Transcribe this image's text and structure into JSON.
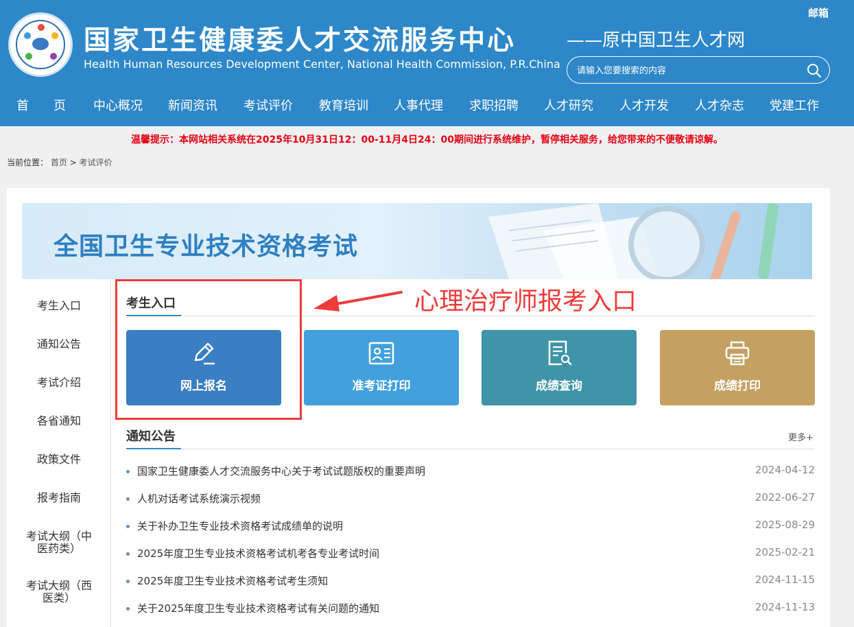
{
  "header": {
    "title_cn": "国家卫生健康委人才交流服务中心",
    "title_en": "Health Human Resources Development Center, National Health Commission, P.R.China",
    "subtitle": "——原中国卫生人才网",
    "mail_link": "邮箱",
    "search": {
      "placeholder": "请输入您要搜索的内容"
    },
    "nav": [
      "首　　页",
      "中心概况",
      "新闻资讯",
      "考试评价",
      "教育培训",
      "人事代理",
      "求职招聘",
      "人才研究",
      "人才开发",
      "人才杂志",
      "党建工作"
    ]
  },
  "notice": "温馨提示：本网站相关系统在2025年10月31日12：00-11月4日24：00期间进行系统维护，暂停相关服务，给您带来的不便敬请谅解。",
  "breadcrumb": {
    "label": "当前位置：",
    "home": "首页",
    "sep": " > ",
    "current": "考试评价"
  },
  "banner": {
    "title": "全国卫生专业技术资格考试"
  },
  "sidebar": [
    "考生入口",
    "通知公告",
    "考试介绍",
    "各省通知",
    "政策文件",
    "报考指南",
    "考试大纲（中医药类）",
    "考试大纲（西医类）"
  ],
  "entry": {
    "title": "考生入口",
    "buttons": [
      {
        "label": "网上报名",
        "icon": "pencil-icon",
        "color": "#3a7ec4"
      },
      {
        "label": "准考证打印",
        "icon": "id-card-icon",
        "color": "#42a0dc"
      },
      {
        "label": "成绩查询",
        "icon": "document-search-icon",
        "color": "#3f94a8"
      },
      {
        "label": "成绩打印",
        "icon": "printer-icon",
        "color": "#c4a062"
      }
    ]
  },
  "news": {
    "title": "通知公告",
    "more": "更多+",
    "items": [
      {
        "title": "国家卫生健康委人才交流服务中心关于考试试题版权的重要声明",
        "date": "2024-04-12"
      },
      {
        "title": "人机对话考试系统演示视频",
        "date": "2022-06-27"
      },
      {
        "title": "关于补办卫生专业技术资格考试成绩单的说明",
        "date": "2025-08-29"
      },
      {
        "title": "2025年度卫生专业技术资格考试机考各专业考试时间",
        "date": "2025-02-21"
      },
      {
        "title": "2025年度卫生专业技术资格考试考生须知",
        "date": "2024-11-15"
      },
      {
        "title": "关于2025年度卫生专业技术资格考试有关问题的通知",
        "date": "2024-11-13"
      }
    ]
  },
  "annotation": {
    "text": "心理治疗师报考入口",
    "color": "#ee3b3b"
  }
}
